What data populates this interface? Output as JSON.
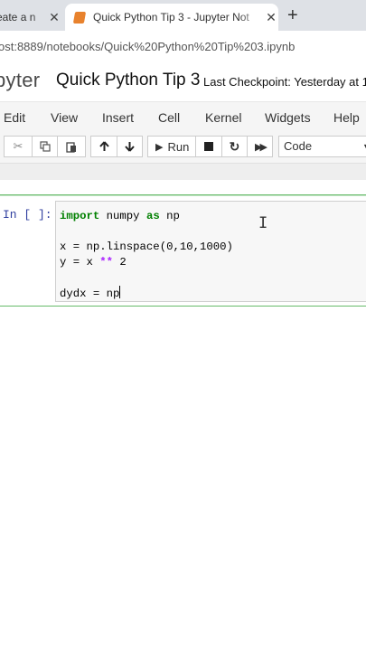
{
  "browser": {
    "tabs": [
      {
        "title": "eate a n",
        "active": false
      },
      {
        "title": "Quick Python Tip 3 - Jupyter Not",
        "active": true
      }
    ],
    "new_tab": "+",
    "url": "ost:8889/notebooks/Quick%20Python%20Tip%203.ipynb"
  },
  "jupyter": {
    "logo_text": "pyter",
    "notebook_title": "Quick Python Tip 3",
    "checkpoint": "Last Checkpoint: Yesterday at 1"
  },
  "menu": [
    "Edit",
    "View",
    "Insert",
    "Cell",
    "Kernel",
    "Widgets",
    "Help"
  ],
  "toolbar": {
    "run_label": "Run",
    "cell_type": "Code",
    "icons": [
      "cut-icon",
      "copy-icon",
      "paste-icon",
      "move-up-icon",
      "move-down-icon",
      "run-icon",
      "stop-icon",
      "restart-icon",
      "fast-forward-icon"
    ]
  },
  "cell": {
    "prompt": "In [ ]:",
    "code": {
      "line1": {
        "kw": "import",
        "rest1": " numpy ",
        "kw2": "as",
        "rest2": " np"
      },
      "line2": "x = np.linspace(0,10,1000)",
      "line3": {
        "pre": "y = x ",
        "op": "**",
        "post": " 2"
      },
      "line4": "dydx = np"
    }
  },
  "colors": {
    "cell_border": "#66bb6a",
    "prompt": "#303f9f",
    "keyword": "#008000"
  }
}
